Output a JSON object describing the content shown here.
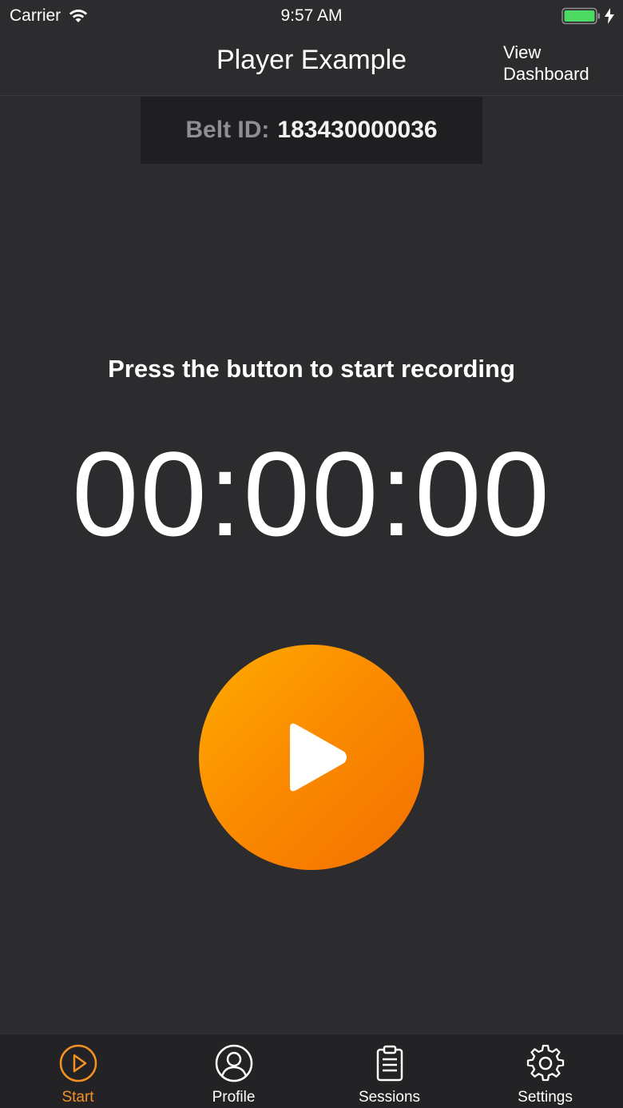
{
  "status_bar": {
    "carrier": "Carrier",
    "time": "9:57 AM",
    "icons": [
      "wifi-icon",
      "battery-icon",
      "charging-bolt-icon"
    ]
  },
  "nav": {
    "title": "Player Example",
    "right_button_line1": "View",
    "right_button_line2": "Dashboard"
  },
  "belt": {
    "label": "Belt ID:",
    "value": "183430000036"
  },
  "main": {
    "prompt": "Press the button to start recording",
    "timer": "00:00:00",
    "record_icon": "play-icon"
  },
  "tabs": [
    {
      "label": "Start",
      "icon": "play-circle-icon",
      "active": true
    },
    {
      "label": "Profile",
      "icon": "user-circle-icon",
      "active": false
    },
    {
      "label": "Sessions",
      "icon": "clipboard-icon",
      "active": false
    },
    {
      "label": "Settings",
      "icon": "gear-icon",
      "active": false
    }
  ],
  "colors": {
    "accent": "#f39223",
    "background": "#2c2c2e",
    "tab_bar": "#232325",
    "button_gradient_start": "#ffab00",
    "button_gradient_end": "#f36f00",
    "battery": "#4cd964"
  }
}
